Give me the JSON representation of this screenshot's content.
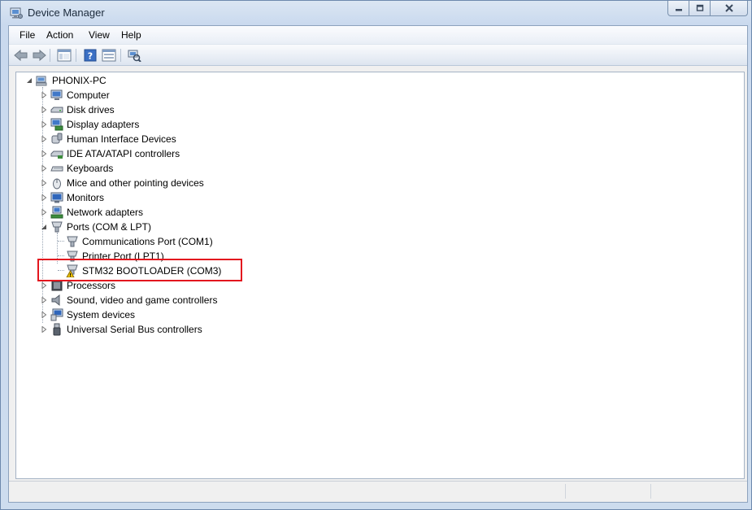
{
  "window": {
    "title": "Device Manager",
    "minimize_label": "",
    "maximize_label": "",
    "close_label": ""
  },
  "menu": {
    "items": [
      "File",
      "Action",
      "View",
      "Help"
    ]
  },
  "toolbar": {
    "buttons": [
      "back-icon",
      "forward-icon",
      "show-hide-console-tree-icon",
      "help-icon",
      "properties-icon",
      "scan-hardware-icon"
    ]
  },
  "tree": {
    "root": "PHONIX-PC",
    "categories": [
      {
        "label": "Computer",
        "icon": "computer-icon"
      },
      {
        "label": "Disk drives",
        "icon": "disk-drive-icon"
      },
      {
        "label": "Display adapters",
        "icon": "display-adapter-icon"
      },
      {
        "label": "Human Interface Devices",
        "icon": "hid-icon"
      },
      {
        "label": "IDE ATA/ATAPI controllers",
        "icon": "ide-controller-icon"
      },
      {
        "label": "Keyboards",
        "icon": "keyboard-icon"
      },
      {
        "label": "Mice and other pointing devices",
        "icon": "mouse-icon"
      },
      {
        "label": "Monitors",
        "icon": "monitor-icon"
      },
      {
        "label": "Network adapters",
        "icon": "network-adapter-icon"
      },
      {
        "label": "Ports (COM & LPT)",
        "icon": "port-icon",
        "expanded": true,
        "children": [
          {
            "label": "Communications Port (COM1)",
            "icon": "port-icon"
          },
          {
            "label": "Printer Port (LPT1)",
            "icon": "port-icon"
          },
          {
            "label": "STM32  BOOTLOADER (COM3)",
            "icon": "port-warning-icon",
            "warning": true
          }
        ]
      },
      {
        "label": "Processors",
        "icon": "processor-icon"
      },
      {
        "label": "Sound, video and game controllers",
        "icon": "speaker-icon"
      },
      {
        "label": "System devices",
        "icon": "system-devices-icon"
      },
      {
        "label": "Universal Serial Bus controllers",
        "icon": "usb-icon"
      }
    ]
  },
  "colors": {
    "highlight_box": "#e3161e",
    "window_frame": "#c9d9ee",
    "warning": "#f2c500"
  }
}
